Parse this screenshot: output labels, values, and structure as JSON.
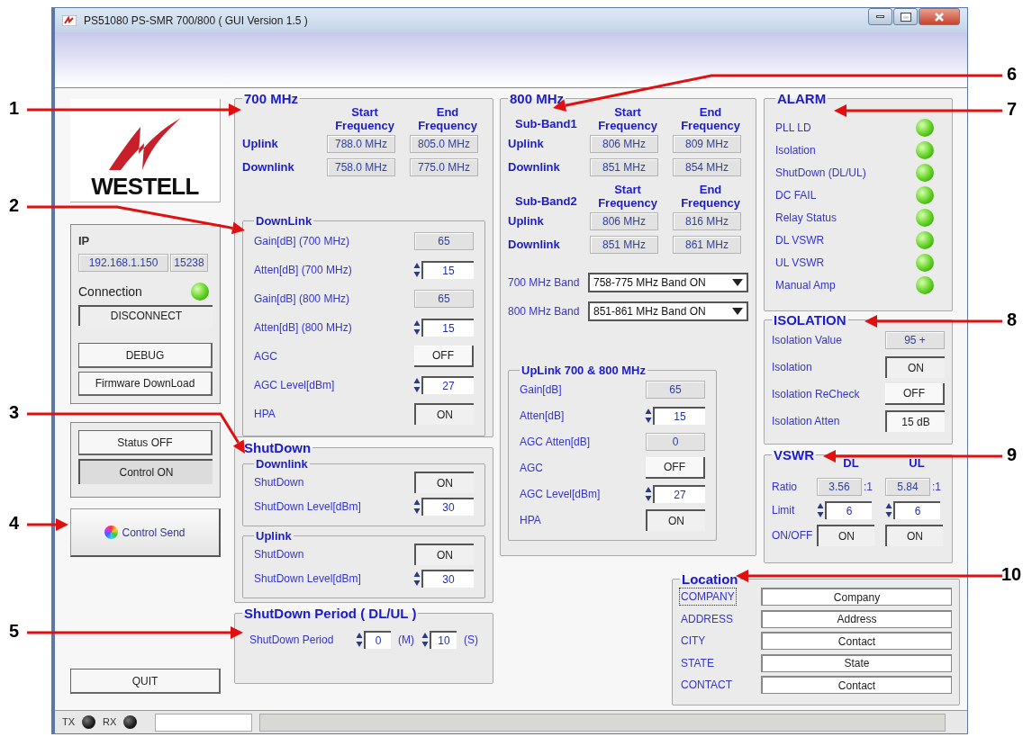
{
  "window": {
    "title": "PS51080 PS-SMR 700/800 ( GUI Version 1.5 )"
  },
  "logo": {
    "text": "WESTELL"
  },
  "connection": {
    "ip_label": "IP",
    "ip": "192.168.1.150",
    "port": "15238",
    "status_label": "Connection",
    "on": true,
    "disconnect": "DISCONNECT",
    "buttons": [
      "DEBUG",
      "Firmware DownLoad"
    ]
  },
  "mode_buttons": [
    {
      "label": "Status OFF",
      "selected": false
    },
    {
      "label": "Control ON",
      "selected": true
    }
  ],
  "send_button": "Control Send",
  "quit_button": "QUIT",
  "band_700": {
    "title": "700 MHz",
    "headers": [
      "Start Frequency",
      "End Frequency"
    ],
    "rows": [
      {
        "label": "Uplink",
        "start": "788.0 MHz",
        "end": "805.0 MHz"
      },
      {
        "label": "Downlink",
        "start": "758.0 MHz",
        "end": "775.0 MHz"
      }
    ]
  },
  "downlink": {
    "title": "DownLink",
    "rows": [
      {
        "kind": "readout",
        "label": "Gain[dB] (700 MHz)",
        "value": "65"
      },
      {
        "kind": "spin",
        "label": "Atten[dB] (700 MHz)",
        "value": "15"
      },
      {
        "kind": "readout",
        "label": "Gain[dB] (800 MHz)",
        "value": "65"
      },
      {
        "kind": "spin",
        "label": "Atten[dB] (800 MHz)",
        "value": "15"
      },
      {
        "kind": "toggle",
        "label": "AGC",
        "value": "OFF",
        "on": false
      },
      {
        "kind": "spin",
        "label": "AGC Level[dBm]",
        "value": "27"
      },
      {
        "kind": "toggle",
        "label": "HPA",
        "value": "ON",
        "on": true
      }
    ]
  },
  "shutdown": {
    "title": "ShutDown",
    "groups": [
      {
        "title": "Downlink",
        "rows": [
          {
            "kind": "toggle",
            "label": "ShutDown",
            "value": "ON",
            "on": true
          },
          {
            "kind": "spin",
            "label": "ShutDown Level[dBm]",
            "value": "30"
          }
        ]
      },
      {
        "title": "Uplink",
        "rows": [
          {
            "kind": "toggle",
            "label": "ShutDown",
            "value": "ON",
            "on": true
          },
          {
            "kind": "spin",
            "label": "ShutDown Level[dBm]",
            "value": "30"
          }
        ]
      }
    ]
  },
  "shutdown_period": {
    "title": "ShutDown Period ( DL/UL )",
    "label": "ShutDown Period",
    "minutes": "0",
    "minutes_unit": "(M)",
    "seconds": "10",
    "seconds_unit": "(S)"
  },
  "band_800": {
    "title": "800 MHz",
    "sub_bands": [
      {
        "title": "Sub-Band1",
        "headers": [
          "Start Frequency",
          "End Frequency"
        ],
        "rows": [
          {
            "label": "Uplink",
            "start": "806 MHz",
            "end": "809 MHz"
          },
          {
            "label": "Downlink",
            "start": "851 MHz",
            "end": "854 MHz"
          }
        ]
      },
      {
        "title": "Sub-Band2",
        "headers": [
          "Start Frequency",
          "End Frequency"
        ],
        "rows": [
          {
            "label": "Uplink",
            "start": "806 MHz",
            "end": "816 MHz"
          },
          {
            "label": "Downlink",
            "start": "851 MHz",
            "end": "861 MHz"
          }
        ]
      }
    ],
    "band_selects": [
      {
        "label": "700 MHz Band",
        "value": "758-775 MHz Band ON"
      },
      {
        "label": "800 MHz Band",
        "value": "851-861 MHz Band ON"
      }
    ]
  },
  "uplink": {
    "title": "UpLink 700 & 800 MHz",
    "rows": [
      {
        "kind": "readout",
        "label": "Gain[dB]",
        "value": "65"
      },
      {
        "kind": "spin",
        "label": "Atten[dB]",
        "value": "15"
      },
      {
        "kind": "readout",
        "label": "AGC Atten[dB]",
        "value": "0"
      },
      {
        "kind": "toggle",
        "label": "AGC",
        "value": "OFF",
        "on": false
      },
      {
        "kind": "spin",
        "label": "AGC Level[dBm]",
        "value": "27"
      },
      {
        "kind": "toggle",
        "label": "HPA",
        "value": "ON",
        "on": true
      }
    ]
  },
  "alarm": {
    "title": "ALARM",
    "items": [
      {
        "label": "PLL LD",
        "on": true
      },
      {
        "label": "Isolation",
        "on": true
      },
      {
        "label": "ShutDown (DL/UL)",
        "on": true
      },
      {
        "label": "DC FAIL",
        "on": true
      },
      {
        "label": "Relay Status",
        "on": true
      },
      {
        "label": "DL VSWR",
        "on": true
      },
      {
        "label": "UL VSWR",
        "on": true
      },
      {
        "label": "Manual Amp",
        "on": true
      }
    ]
  },
  "isolation": {
    "title": "ISOLATION",
    "rows": [
      {
        "kind": "readout",
        "label": "Isolation Value",
        "value": "95 +"
      },
      {
        "kind": "toggle",
        "label": "Isolation",
        "value": "ON",
        "on": true
      },
      {
        "kind": "toggle",
        "label": "Isolation ReCheck",
        "value": "OFF",
        "on": false
      },
      {
        "kind": "field",
        "label": "Isolation Atten",
        "value": "15 dB"
      }
    ]
  },
  "vswr": {
    "title": "VSWR",
    "columns": [
      "DL",
      "UL"
    ],
    "ratio": {
      "label": "Ratio",
      "values": [
        {
          "value": "3.56",
          "unit": ":1"
        },
        {
          "value": "5.84",
          "unit": ":1"
        }
      ]
    },
    "limit": {
      "label": "Limit",
      "values": [
        "6",
        "6"
      ]
    },
    "switch": {
      "label": "ON/OFF",
      "values": [
        {
          "value": "ON",
          "on": true
        },
        {
          "value": "ON",
          "on": true
        }
      ]
    }
  },
  "location": {
    "title": "Location",
    "rows": [
      {
        "label": "COMPANY",
        "value": "Company",
        "focused": true
      },
      {
        "label": "ADDRESS",
        "value": "Address",
        "focused": false
      },
      {
        "label": "CITY",
        "value": "Contact",
        "focused": false
      },
      {
        "label": "STATE",
        "value": "State",
        "focused": false
      },
      {
        "label": "CONTACT",
        "value": "Contact",
        "focused": false
      }
    ]
  },
  "status_bar": {
    "tx_label": "TX",
    "tx_on": false,
    "rx_label": "RX",
    "rx_on": false
  },
  "callouts": [
    "1",
    "2",
    "3",
    "4",
    "5",
    "6",
    "7",
    "8",
    "9",
    "10"
  ]
}
